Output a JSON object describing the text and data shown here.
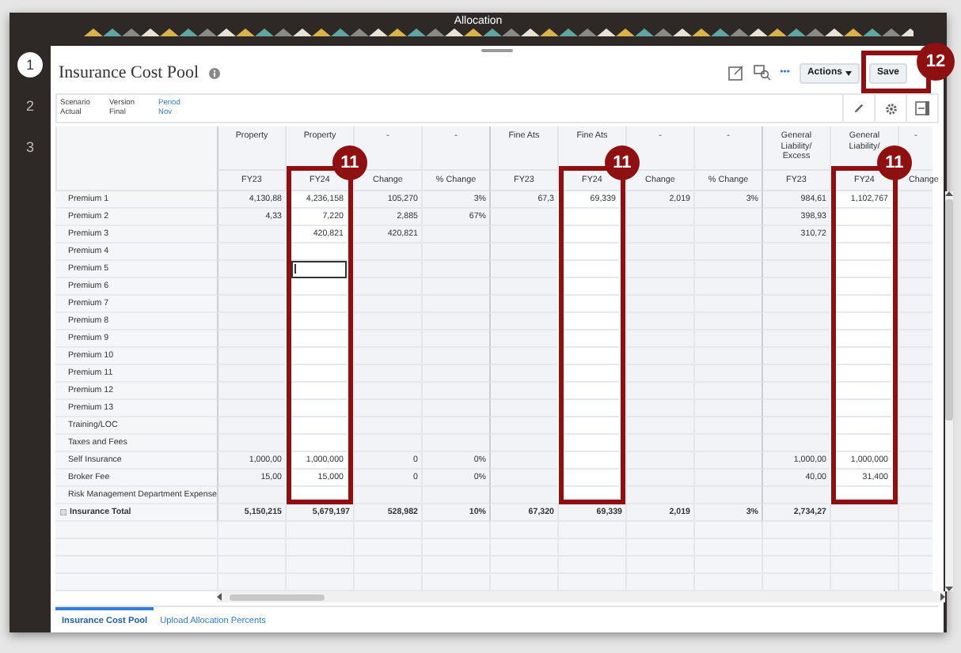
{
  "banner": {
    "title": "Allocation"
  },
  "steps": [
    {
      "label": "1",
      "selected": true
    },
    {
      "label": "2",
      "selected": false
    },
    {
      "label": "3",
      "selected": false
    }
  ],
  "page": {
    "title": "Insurance Cost Pool"
  },
  "toolbar": {
    "more": "•••",
    "buttons": [
      {
        "label": "Actions",
        "dropdown": true
      },
      {
        "label": "Save",
        "dropdown": false,
        "callout": "12"
      }
    ]
  },
  "pov": [
    {
      "label": "Scenario",
      "value": "Actual",
      "link": false
    },
    {
      "label": "Version",
      "value": "Final",
      "link": false
    },
    {
      "label": "Period",
      "value": "Nov",
      "link": true
    }
  ],
  "columns": [
    {
      "group": "Property",
      "header": "FY23",
      "editable": false,
      "cursor": false
    },
    {
      "group": "Property",
      "header": "FY24",
      "editable": true,
      "cursor": true,
      "callout": "11"
    },
    {
      "group": "-",
      "header": "Change",
      "editable": false,
      "cursor": false
    },
    {
      "group": "-",
      "header": "% Change",
      "editable": false,
      "cursor": false
    },
    {
      "group": "Fine Ats",
      "header": "FY23",
      "editable": false,
      "cursor": false
    },
    {
      "group": "Fine Ats",
      "header": "FY24",
      "editable": true,
      "cursor": false,
      "callout": "11"
    },
    {
      "group": "-",
      "header": "Change",
      "editable": false,
      "cursor": false
    },
    {
      "group": "-",
      "header": "% Change",
      "editable": false,
      "cursor": false
    },
    {
      "group": "General Liability/ Excess",
      "header": "FY23",
      "editable": false,
      "cursor": false
    },
    {
      "group": "General Liability/",
      "header": "FY24",
      "editable": true,
      "cursor": false,
      "callout": "11"
    },
    {
      "group": "-",
      "header": "Change",
      "editable": false,
      "cursor": false
    }
  ],
  "rows": [
    {
      "label": "Premium 1",
      "kind": "item",
      "editing": false,
      "cells": [
        "4,130,88",
        "4,236,158",
        "105,270",
        "3%",
        "67,3",
        "69,339",
        "2,019",
        "3%",
        "984,61",
        "1,102,767",
        ""
      ]
    },
    {
      "label": "Premium 2",
      "kind": "item",
      "editing": false,
      "cells": [
        "4,33",
        "7,220",
        "2,885",
        "67%",
        "",
        "",
        "",
        "",
        "398,93",
        "",
        ""
      ]
    },
    {
      "label": "Premium 3",
      "kind": "item",
      "editing": false,
      "cells": [
        "",
        "420,821",
        "420,821",
        "",
        "",
        "",
        "",
        "",
        "310,72",
        "",
        ""
      ]
    },
    {
      "label": "Premium 4",
      "kind": "item",
      "editing": false,
      "cells": [
        "",
        "",
        "",
        "",
        "",
        "",
        "",
        "",
        "",
        "",
        ""
      ]
    },
    {
      "label": "Premium 5",
      "kind": "item",
      "editing": true,
      "cells": [
        "",
        "",
        "",
        "",
        "",
        "",
        "",
        "",
        "",
        "",
        ""
      ]
    },
    {
      "label": "Premium 6",
      "kind": "item",
      "editing": false,
      "cells": [
        "",
        "",
        "",
        "",
        "",
        "",
        "",
        "",
        "",
        "",
        ""
      ]
    },
    {
      "label": "Premium 7",
      "kind": "item",
      "editing": false,
      "cells": [
        "",
        "",
        "",
        "",
        "",
        "",
        "",
        "",
        "",
        "",
        ""
      ]
    },
    {
      "label": "Premium 8",
      "kind": "item",
      "editing": false,
      "cells": [
        "",
        "",
        "",
        "",
        "",
        "",
        "",
        "",
        "",
        "",
        ""
      ]
    },
    {
      "label": "Premium 9",
      "kind": "item",
      "editing": false,
      "cells": [
        "",
        "",
        "",
        "",
        "",
        "",
        "",
        "",
        "",
        "",
        ""
      ]
    },
    {
      "label": "Premium 10",
      "kind": "item",
      "editing": false,
      "cells": [
        "",
        "",
        "",
        "",
        "",
        "",
        "",
        "",
        "",
        "",
        ""
      ]
    },
    {
      "label": "Premium 11",
      "kind": "item",
      "editing": false,
      "cells": [
        "",
        "",
        "",
        "",
        "",
        "",
        "",
        "",
        "",
        "",
        ""
      ]
    },
    {
      "label": "Premium 12",
      "kind": "item",
      "editing": false,
      "cells": [
        "",
        "",
        "",
        "",
        "",
        "",
        "",
        "",
        "",
        "",
        ""
      ]
    },
    {
      "label": "Premium 13",
      "kind": "item",
      "editing": false,
      "cells": [
        "",
        "",
        "",
        "",
        "",
        "",
        "",
        "",
        "",
        "",
        ""
      ]
    },
    {
      "label": "Training/LOC",
      "kind": "item",
      "editing": false,
      "cells": [
        "",
        "",
        "",
        "",
        "",
        "",
        "",
        "",
        "",
        "",
        ""
      ]
    },
    {
      "label": "Taxes and Fees",
      "kind": "item",
      "editing": false,
      "cells": [
        "",
        "",
        "",
        "",
        "",
        "",
        "",
        "",
        "",
        "",
        ""
      ]
    },
    {
      "label": "Self Insurance",
      "kind": "item",
      "editing": false,
      "cells": [
        "1,000,00",
        "1,000,000",
        "0",
        "0%",
        "",
        "",
        "",
        "",
        "1,000,00",
        "1,000,000",
        ""
      ]
    },
    {
      "label": "Broker Fee",
      "kind": "item",
      "editing": false,
      "cells": [
        "15,00",
        "15,000",
        "0",
        "0%",
        "",
        "",
        "",
        "",
        "40,00",
        "31,400",
        ""
      ]
    },
    {
      "label": "Risk Management Department Expense",
      "kind": "item",
      "editing": false,
      "cells": [
        "",
        "",
        "",
        "",
        "",
        "",
        "",
        "",
        "",
        "",
        ""
      ]
    },
    {
      "label": "Insurance Total",
      "kind": "total",
      "editing": false,
      "cells": [
        "5,150,215",
        "5,679,197",
        "528,982",
        "10%",
        "67,320",
        "69,339",
        "2,019",
        "3%",
        "2,734,27",
        "",
        ""
      ]
    }
  ],
  "tabs": [
    {
      "label": "Insurance Cost Pool",
      "selected": true
    },
    {
      "label": "Upload Allocation Percents",
      "selected": false
    }
  ]
}
